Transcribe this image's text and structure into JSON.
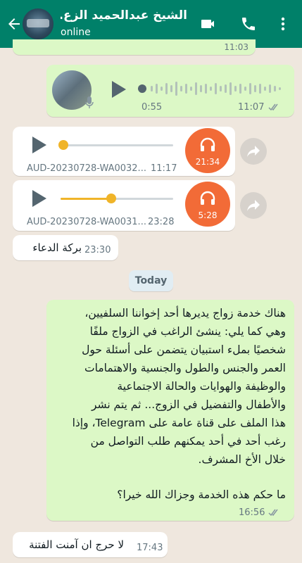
{
  "header": {
    "title": "الشيخ عبدالحميد الزع...",
    "status": "online"
  },
  "top_partial": {
    "time": "11:03"
  },
  "voice_note": {
    "duration": "0:55",
    "time": "11:07"
  },
  "audio_messages": [
    {
      "filename": "AUD-20230728-WA0032...",
      "time": "11:17",
      "duration": "21:34",
      "progress": 0.0
    },
    {
      "filename": "AUD-20230728-WA0031...",
      "time": "23:28",
      "duration": "5:28",
      "progress": 0.45
    }
  ],
  "msg_blessing": {
    "text": "بركة الدعاء",
    "time": "23:30"
  },
  "date_separator": "Today",
  "long_message": {
    "lines": [
      "هناك خدمة زواج يديرها أحد إخواننا السلفيين،",
      "وهي كما يلي: ينشئ الراغب في الزواج ملفًا",
      "شخصيًا بملء استبيان يتضمن على أسئلة حول",
      "العمر والجنس والطول والجنسية والاهتمامات",
      "والوظيفة والهوايات والحالة الاجتماعية",
      "والأطفال والتفضيل في الزوج... ثم يتم نشر",
      "هذا الملف على قناة عامة على Telegram، وإذا",
      "رغب أحد في أحد يمكنهم طلب التواصل من",
      "خلال الأخ المشرف."
    ],
    "question": "ما حكم هذه الخدمة وجزاك الله خيرا؟",
    "time": "16:56"
  },
  "reply": {
    "text": "لا حرج ان آمنت الفتنة",
    "time": "17:43"
  },
  "colors": {
    "header": "#008069",
    "outgoing": "#dcf8c6",
    "incoming": "#ffffff",
    "accent": "#f26b37"
  }
}
